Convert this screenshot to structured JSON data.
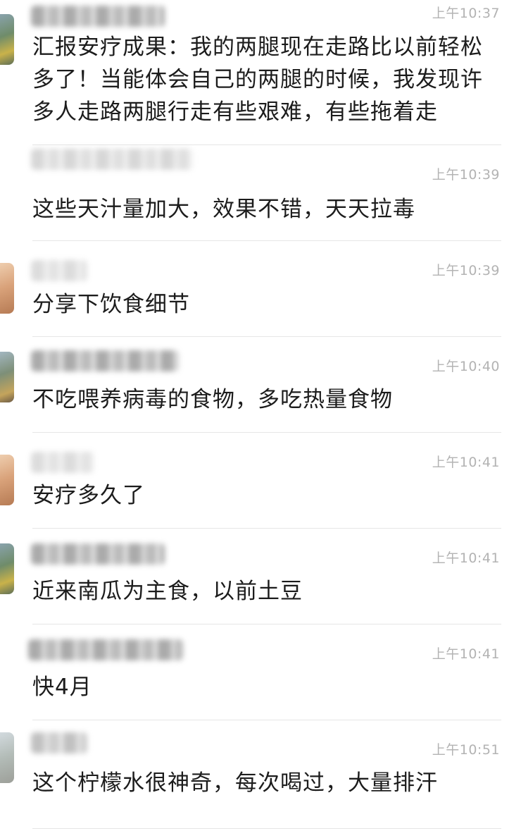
{
  "messages": [
    {
      "time": "上午10:37",
      "text": "汇报安疗成果：我的两腿现在走路比以前轻松多了！当能体会自己的两腿的时候，我发现许多人走路两腿行走有些艰难，有些拖着走"
    },
    {
      "time": "上午10:39",
      "text": "这些天汁量加大，效果不错，天天拉毒"
    },
    {
      "time": "上午10:39",
      "text": "分享下饮食细节"
    },
    {
      "time": "上午10:40",
      "text": "不吃喂养病毒的食物，多吃热量食物"
    },
    {
      "time": "上午10:41",
      "text": "安疗多久了"
    },
    {
      "time": "上午10:41",
      "text": "近来南瓜为主食，以前土豆"
    },
    {
      "time": "上午10:41",
      "text": "快4月"
    },
    {
      "time": "上午10:51",
      "text": "这个柠檬水很神奇，每次喝过，大量排汗"
    }
  ]
}
